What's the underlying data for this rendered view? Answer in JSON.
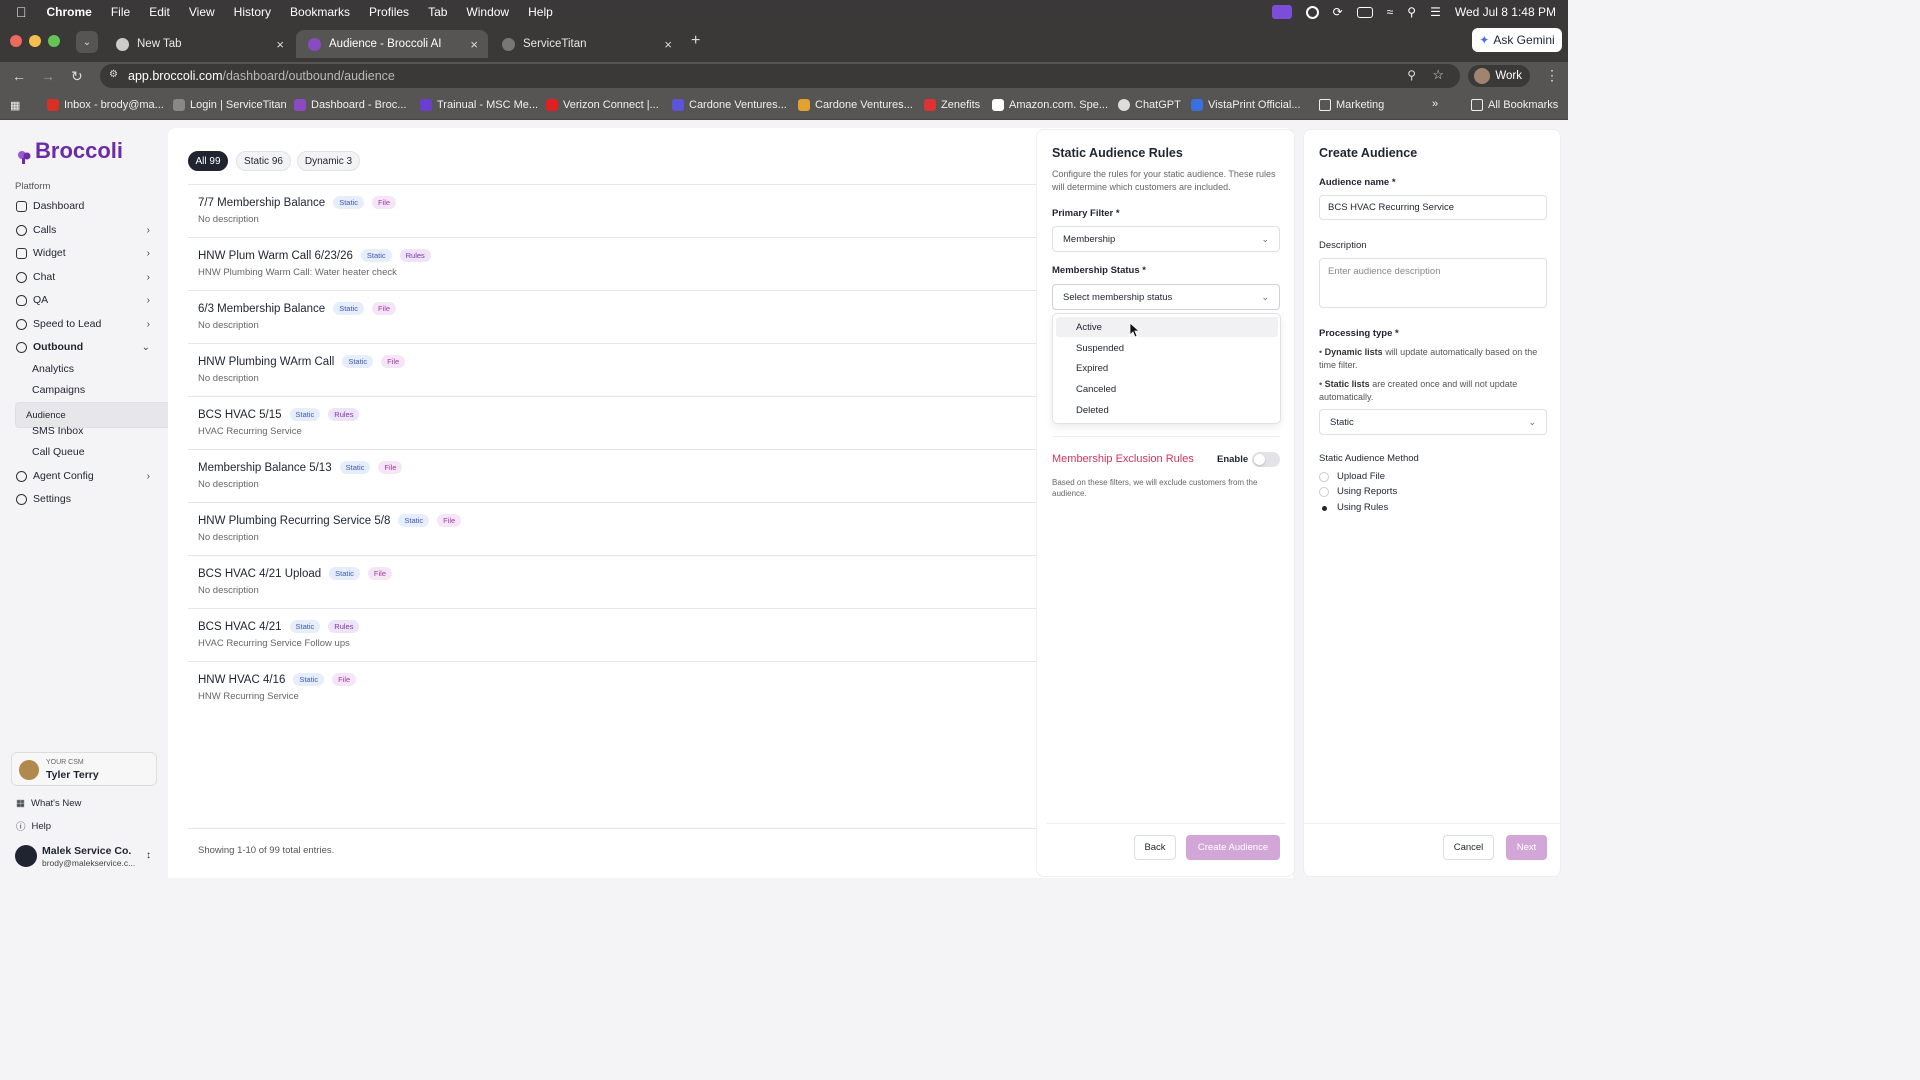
{
  "menubar": {
    "app": "Chrome",
    "items": [
      "File",
      "Edit",
      "View",
      "History",
      "Bookmarks",
      "Profiles",
      "Tab",
      "Window",
      "Help"
    ],
    "clock": "Wed Jul 8  1:48 PM"
  },
  "tabs": [
    {
      "label": "New Tab"
    },
    {
      "label": "Audience - Broccoli AI"
    },
    {
      "label": "ServiceTitan"
    }
  ],
  "ask_gemini": "Ask Gemini",
  "address": {
    "host": "app.broccoli.com",
    "path": "/dashboard/outbound/audience"
  },
  "profile": "Work",
  "bookmarks": [
    "Inbox - brody@ma...",
    "Login | ServiceTitan",
    "Dashboard - Broc...",
    "Trainual - MSC Me...",
    "Verizon Connect |...",
    "Cardone Ventures...",
    "Cardone Ventures...",
    "Zenefits",
    "Amazon.com. Spe...",
    "ChatGPT",
    "VistaPrint Official...",
    "Marketing"
  ],
  "all_bookmarks": "All Bookmarks",
  "sidebar": {
    "logo": "Broccoli",
    "section": "Platform",
    "nav": [
      "Dashboard",
      "Calls",
      "Widget",
      "Chat",
      "QA",
      "Speed to Lead",
      "Outbound"
    ],
    "outbound_sub": [
      "Analytics",
      "Campaigns",
      "Audience",
      "SMS Inbox",
      "Call Queue"
    ],
    "nav2": [
      "Agent Config",
      "Settings"
    ],
    "csm_label": "YOUR CSM",
    "csm_name": "Tyler Terry",
    "whats_new": "What's New",
    "help": "Help",
    "account_name": "Malek Service Co.",
    "account_email": "brody@malekservice.c..."
  },
  "filters": [
    "All 99",
    "Static 96",
    "Dynamic 3"
  ],
  "audiences": [
    {
      "name": "7/7 Membership Balance",
      "type": "Static",
      "source": "File",
      "desc": "No description"
    },
    {
      "name": "HNW Plum Warm Call 6/23/26",
      "type": "Static",
      "source": "Rules",
      "desc": "HNW Plumbing Warm Call: Water heater check"
    },
    {
      "name": "6/3 Membership Balance",
      "type": "Static",
      "source": "File",
      "desc": "No description"
    },
    {
      "name": "HNW Plumbing WArm Call",
      "type": "Static",
      "source": "File",
      "desc": "No description"
    },
    {
      "name": "BCS HVAC 5/15",
      "type": "Static",
      "source": "Rules",
      "desc": "HVAC Recurring Service"
    },
    {
      "name": "Membership Balance 5/13",
      "type": "Static",
      "source": "File",
      "desc": "No description"
    },
    {
      "name": "HNW Plumbing Recurring Service 5/8",
      "type": "Static",
      "source": "File",
      "desc": "No description"
    },
    {
      "name": "BCS HVAC 4/21 Upload",
      "type": "Static",
      "source": "File",
      "desc": "No description"
    },
    {
      "name": "BCS HVAC 4/21",
      "type": "Static",
      "source": "Rules",
      "desc": "HVAC Recurring Service Follow ups"
    },
    {
      "name": "HNW HVAC 4/16",
      "type": "Static",
      "source": "File",
      "desc": "HNW Recurring Service"
    }
  ],
  "showing": "Showing 1-10 of 99 total entries.",
  "rules_panel": {
    "title": "Static Audience Rules",
    "desc": "Configure the rules for your static audience. These rules will determine which customers are included.",
    "primary_label": "Primary Filter *",
    "primary_value": "Membership",
    "status_label": "Membership Status *",
    "status_placeholder": "Select membership status",
    "options": [
      "Active",
      "Suspended",
      "Expired",
      "Canceled",
      "Deleted"
    ],
    "exclusion_title": "Membership Exclusion Rules",
    "enable_label": "Enable",
    "exclusion_desc": "Based on these filters, we will exclude customers from the audience.",
    "back": "Back",
    "create": "Create Audience"
  },
  "create_panel": {
    "title": "Create Audience",
    "name_label": "Audience name *",
    "name_value": "BCS HVAC Recurring Service",
    "desc_label": "Description",
    "desc_placeholder": "Enter audience description",
    "processing_label": "Processing type *",
    "dynamic_bold": "Dynamic lists",
    "dynamic_text": " will update automatically based on the time filter.",
    "static_bold": "Static lists",
    "static_text": " are created once and will not update automatically.",
    "processing_value": "Static",
    "method_label": "Static Audience Method",
    "methods": [
      "Upload File",
      "Using Reports",
      "Using Rules"
    ],
    "cancel": "Cancel",
    "next": "Next"
  },
  "colors": {
    "brand": "#6b2da3",
    "exclusion": "#d1365a",
    "primary_btn_disabled": "#d3a6d8"
  }
}
